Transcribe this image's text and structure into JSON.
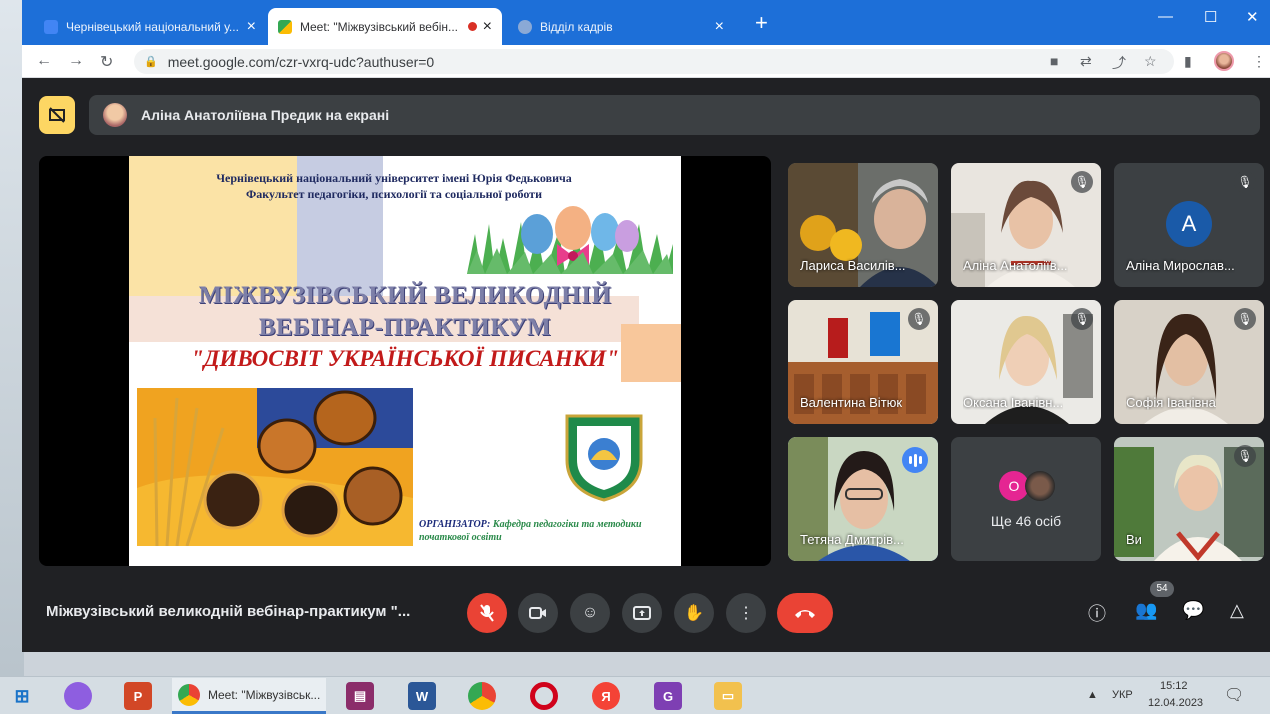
{
  "tabs": [
    {
      "title": "Чернівецький національний у...",
      "color": "#4285f4"
    },
    {
      "title": "Meet: \"Міжвузівський вебін...",
      "color": "#34a853"
    },
    {
      "title": "Відділ кадрів",
      "color": "#8aa9d6"
    }
  ],
  "address": {
    "url": "meet.google.com/czr-vxrq-udc?authuser=0"
  },
  "presentation": {
    "text": "Аліна Анатоліївна Предик на екрані"
  },
  "slide": {
    "university": "Чернівецький національний університет імені Юрія Федьковича",
    "faculty": "Факультет педагогіки, психології та соціальної роботи",
    "title_line1": "МІЖВУЗІВСЬКИЙ ВЕЛИКОДНІЙ",
    "title_line2": "ВЕБІНАР-ПРАКТИКУМ",
    "subtitle": "\"ДИВОСВІТ УКРАЇНСЬКОЇ ПИСАНКИ\"",
    "organizer_label": "ОРГАНІЗАТОР:",
    "organizer_text": "Кафедра педагогіки та методики початкової освіти"
  },
  "participants": [
    {
      "name": "Лариса Василів..."
    },
    {
      "name": "Аліна Анатоліїв..."
    },
    {
      "name": "Аліна Мирослав...",
      "initial": "A"
    },
    {
      "name": "Валентина Вітюк"
    },
    {
      "name": "Оксана Іванівн..."
    },
    {
      "name": "Софія Іванівна"
    },
    {
      "name": "Тетяна Дмитрів..."
    },
    {
      "name": "Ще 46 осіб",
      "initial": "О"
    },
    {
      "name": "Ви"
    }
  ],
  "meeting": {
    "title": "Міжвузівський великодній вебінар-практикум \"...",
    "participant_count": "54"
  },
  "taskbar": {
    "active_app": "Meet: \"Міжвузівськ...",
    "lang": "УКР",
    "time": "15:12",
    "date": "12.04.2023"
  },
  "colors": {
    "accent": "#1d6fd8",
    "meet_bg": "#202124",
    "danger": "#ea4335",
    "present": "#fdd663"
  }
}
